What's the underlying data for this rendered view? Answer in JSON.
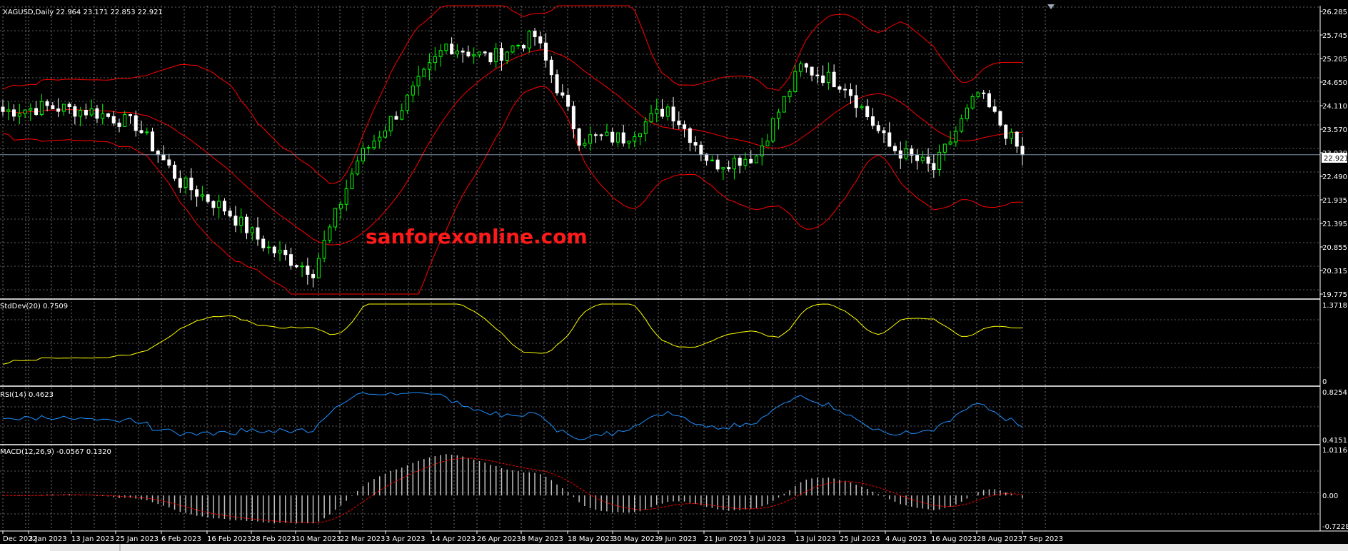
{
  "window": {
    "symbol_title": "XAGUSD,Daily",
    "info_line": "XAGUSD,Daily  22.964 23.171 22.853 22.921"
  },
  "watermark": {
    "text": "sanforexonline.com"
  },
  "main_pane": {
    "price_axis_labels": [
      "26.285",
      "25.745",
      "25.205",
      "24.650",
      "24.110",
      "23.570",
      "23.030",
      "22.490",
      "21.935",
      "21.395",
      "20.855",
      "20.315",
      "19.775"
    ],
    "current_price_label": "22.921",
    "current_price": 22.921,
    "ylim": [
      19.775,
      26.285
    ]
  },
  "stddev_pane": {
    "label": "StdDev(20) 0.7509",
    "axis_labels": [
      "1.3718",
      "0"
    ],
    "ylim": [
      0,
      1.3718
    ]
  },
  "rsi_pane": {
    "label": "RSI(14) 0.4623",
    "axis_labels": [
      "0.8254",
      "0.4151"
    ],
    "ylim": [
      0.4151,
      0.8254
    ]
  },
  "macd_pane": {
    "label": "MACD(12,26,9) -0.0567 0.1320",
    "axis_labels": [
      "1.0116",
      "0.00",
      "-0.7228"
    ],
    "ylim": [
      -0.7228,
      1.0116
    ]
  },
  "time_axis": {
    "labels": [
      "Dec 2022",
      "3 Jan 2023",
      "13 Jan 2023",
      "25 Jan 2023",
      "6 Feb 2023",
      "16 Feb 2023",
      "28 Feb 2023",
      "10 Mar 2023",
      "22 Mar 2023",
      "3 Apr 2023",
      "14 Apr 2023",
      "26 Apr 2023",
      "8 May 2023",
      "18 May 2023",
      "30 May 2023",
      "9 Jun 2023",
      "21 Jun 2023",
      "3 Jul 2023",
      "13 Jul 2023",
      "25 Jul 2023",
      "4 Aug 2023",
      "16 Aug 2023",
      "28 Aug 2023",
      "7 Sep 2023"
    ]
  },
  "colors": {
    "background": "#000000",
    "grid": "#c0c0c0",
    "candle_up": "#00ff00",
    "candle_down": "#ffffff",
    "bollinger": "#ff0000",
    "stddev_line": "#ffff00",
    "rsi_line": "#1e90ff",
    "macd_hist": "#c0c0c0",
    "macd_signal": "#ff0000",
    "watermark": "#ff1a1a"
  },
  "chart_data": {
    "type": "candlestick",
    "interval": "daily",
    "price_anchors": [
      [
        "Dec 2022",
        23.9
      ],
      [
        "3 Jan 2023",
        24.0
      ],
      [
        "13 Jan 2023",
        23.9
      ],
      [
        "25 Jan 2023",
        23.6
      ],
      [
        "6 Feb 2023",
        22.3
      ],
      [
        "16 Feb 2023",
        21.7
      ],
      [
        "28 Feb 2023",
        20.8
      ],
      [
        "10 Mar 2023",
        20.3
      ],
      [
        "22 Mar 2023",
        22.8
      ],
      [
        "3 Apr 2023",
        24.0
      ],
      [
        "14 Apr 2023",
        25.4
      ],
      [
        "26 Apr 2023",
        25.1
      ],
      [
        "8 May 2023",
        25.6
      ],
      [
        "18 May 2023",
        23.3
      ],
      [
        "30 May 2023",
        23.3
      ],
      [
        "9 Jun 2023",
        24.0
      ],
      [
        "21 Jun 2023",
        22.7
      ],
      [
        "3 Jul 2023",
        22.9
      ],
      [
        "13 Jul 2023",
        24.9
      ],
      [
        "25 Jul 2023",
        24.5
      ],
      [
        "4 Aug 2023",
        23.1
      ],
      [
        "16 Aug 2023",
        22.6
      ],
      [
        "28 Aug 2023",
        24.3
      ],
      [
        "7 Sep 2023",
        22.92
      ]
    ],
    "series": [
      {
        "name": "Bollinger Upper"
      },
      {
        "name": "Bollinger Middle"
      },
      {
        "name": "Bollinger Lower"
      },
      {
        "name": "StdDev(20)"
      },
      {
        "name": "RSI(14)"
      },
      {
        "name": "MACD(12,26,9)"
      }
    ]
  }
}
